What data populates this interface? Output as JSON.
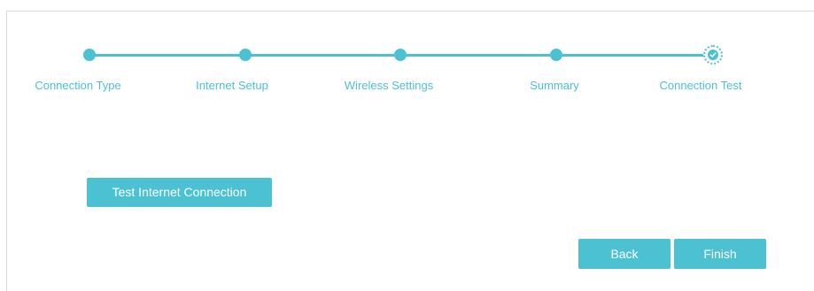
{
  "wizard": {
    "steps": [
      {
        "label": "Connection Type",
        "state": "completed"
      },
      {
        "label": "Internet Setup",
        "state": "completed"
      },
      {
        "label": "Wireless Settings",
        "state": "completed"
      },
      {
        "label": "Summary",
        "state": "completed"
      },
      {
        "label": "Connection Test",
        "state": "current"
      }
    ],
    "accent_color": "#4bc1d2"
  },
  "actions": {
    "test_label": "Test Internet Connection",
    "back_label": "Back",
    "finish_label": "Finish"
  }
}
